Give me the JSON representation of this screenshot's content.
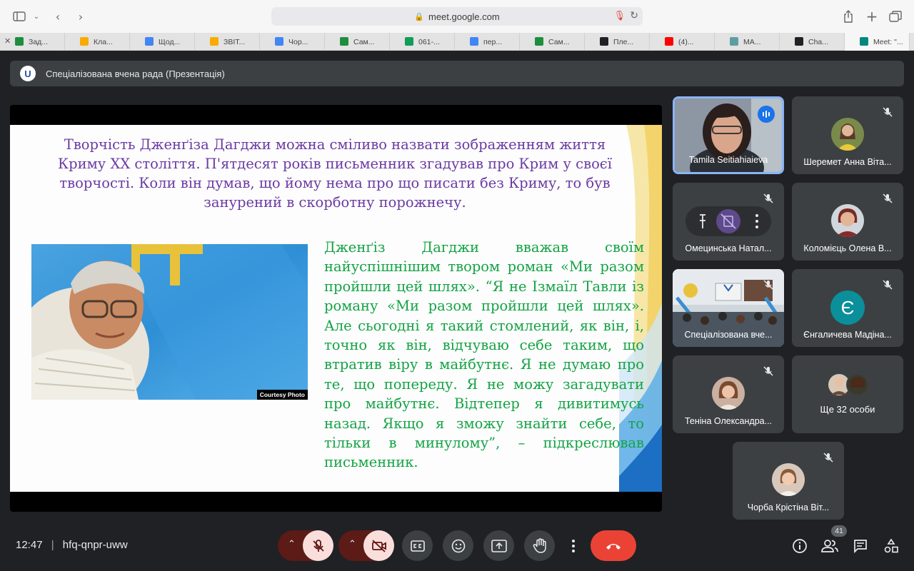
{
  "browser": {
    "url": "meet.google.com",
    "tabs": [
      {
        "label": "Зад...",
        "icon": "google-classroom-icon",
        "color": "#1e8e3e"
      },
      {
        "label": "Кла...",
        "icon": "google-classroom-icon",
        "color": "#f9ab00"
      },
      {
        "label": "Щод...",
        "icon": "google-docs-icon",
        "color": "#4285f4"
      },
      {
        "label": "ЗВІТ...",
        "icon": "google-classroom-icon",
        "color": "#f9ab00"
      },
      {
        "label": "Чор...",
        "icon": "google-docs-icon",
        "color": "#4285f4"
      },
      {
        "label": "Сам...",
        "icon": "google-classroom-icon",
        "color": "#1e8e3e"
      },
      {
        "label": "061-...",
        "icon": "google-sheets-icon",
        "color": "#0f9d58"
      },
      {
        "label": "пер...",
        "icon": "google-search-icon",
        "color": "#4285f4"
      },
      {
        "label": "Сам...",
        "icon": "google-classroom-icon",
        "color": "#1e8e3e"
      },
      {
        "label": "Пле...",
        "icon": "player-icon",
        "color": "#202124"
      },
      {
        "label": "(4)...",
        "icon": "youtube-icon",
        "color": "#ff0000"
      },
      {
        "label": "МА...",
        "icon": "document-icon",
        "color": "#5f9ea0"
      },
      {
        "label": "Cha...",
        "icon": "chatgpt-icon",
        "color": "#202124"
      },
      {
        "label": "Meet: \"...",
        "icon": "google-meet-icon",
        "color": "#00897b"
      }
    ]
  },
  "meeting": {
    "title": "Спеціалізована вчена рада (Презентація)",
    "time": "12:47",
    "code": "hfq-qnpr-uww",
    "participant_count": "41"
  },
  "slide": {
    "top_text": "Творчість Дженґіза Дагджи можна сміливо назвати зображенням життя Криму ХХ століття. П'ятдесят років письменник згадував про Крим у своєї творчості. Коли він думав, що йому нема про що писати без Криму, то був занурений в скорботну порожнечу.",
    "body_text": "Дженґіз Дагджи вважав своїм найуспішнішим твором роман «Ми разом пройшли цей шлях». “Я не Ізмаїл Тавли із роману «Ми разом пройшли цей шлях». Але сьогодні я такий стомлений, як він, і, точно як він, відчуваю себе таким, що втратив віру в майбутнє. Я не думаю про те, що попереду. Я не можу загадувати про майбутнє. Відтепер я дивитимусь назад. Якщо я зможу знайти себе, то тільки в минулому”, – підкреслював письменник.",
    "photo_caption": "Courtesy Photo"
  },
  "participants": [
    {
      "name": "Tamila Seitiahiaieva",
      "speaking": true
    },
    {
      "name": "Шеремет Анна Віта..."
    },
    {
      "name": "Омецинська Натал..."
    },
    {
      "name": "Коломієць Олена В..."
    },
    {
      "name": "Спеціалізована вче..."
    },
    {
      "name": "Єнгаличева Мадіна...",
      "letter": "Є"
    },
    {
      "name": "Теніна Олександра..."
    },
    {
      "name": "Ще 32 особи"
    },
    {
      "name": "Чорба Крістіна Віт..."
    }
  ]
}
